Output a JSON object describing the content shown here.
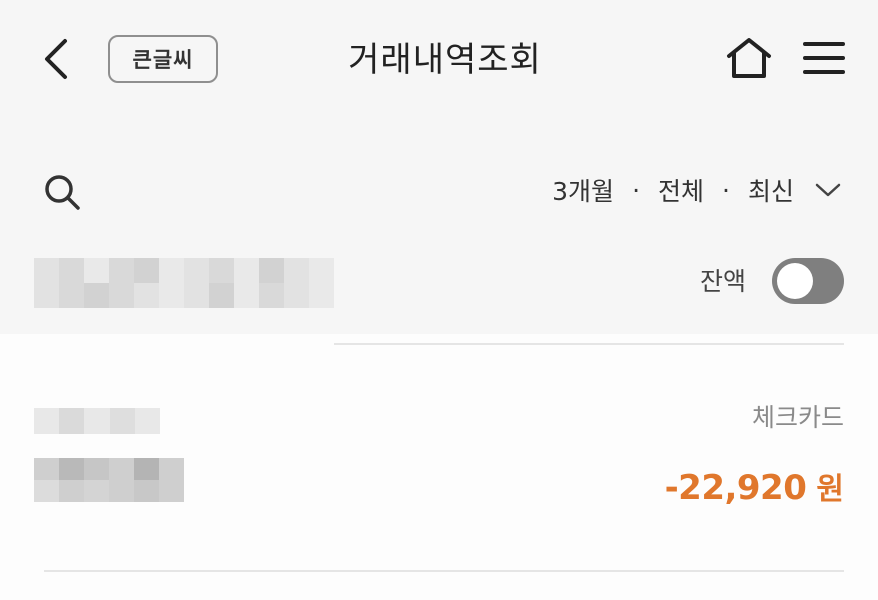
{
  "header": {
    "back_icon": "chevron-left-icon",
    "bigtext_label": "큰글씨",
    "title": "거래내역조회",
    "home_icon": "home-icon",
    "menu_icon": "hamburger-menu-icon"
  },
  "filter": {
    "search_icon": "search-icon",
    "period": "3개월",
    "type": "전체",
    "sort": "최신",
    "separator": "·",
    "dropdown_icon": "chevron-down-icon"
  },
  "account": {
    "balance_label": "잔액",
    "balance_toggle_on": false
  },
  "transactions": [
    {
      "type_label": "체크카드",
      "amount": "-22,920",
      "currency": "원"
    }
  ],
  "colors": {
    "accent_amount": "#e0772c",
    "toggle_off": "#7f7f7f",
    "background": "#f6f6f6"
  }
}
